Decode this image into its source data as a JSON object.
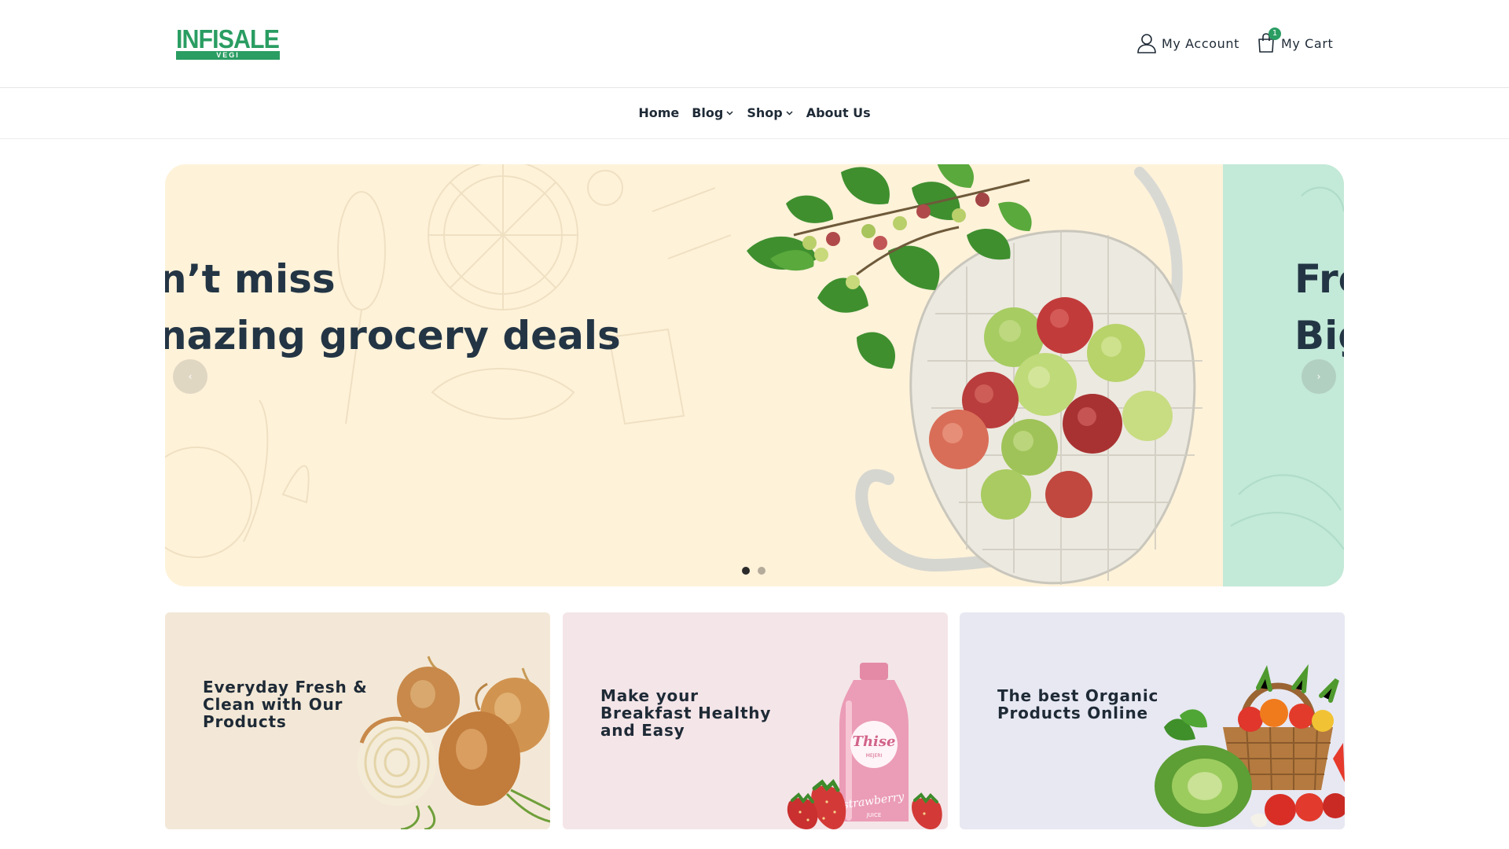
{
  "brand": {
    "name": "INFISALE",
    "sub": "VEGI",
    "color": "#2a9d62"
  },
  "header": {
    "account_label": "My Account",
    "cart_label": "My Cart",
    "cart_count": "1",
    "account_icon": "user-icon",
    "cart_icon": "shopping-bag-icon"
  },
  "nav": {
    "items": [
      {
        "label": "Home",
        "dropdown": false
      },
      {
        "label": "Blog",
        "dropdown": true
      },
      {
        "label": "Shop",
        "dropdown": true
      },
      {
        "label": "About Us",
        "dropdown": false
      }
    ]
  },
  "hero": {
    "slides": [
      {
        "line1": "n’t miss",
        "line2": "nazing grocery deals",
        "bg": "#fef2d9"
      },
      {
        "line1": "Fre",
        "line2": "Big",
        "bg": "#c3e9d8"
      }
    ],
    "prev_label": "‹",
    "next_label": "›",
    "active_dot": 0
  },
  "promos": [
    {
      "title": "Everyday Fresh & Clean with Our Products",
      "bg": "#f3e8d7",
      "art": "onions"
    },
    {
      "title": "Make your Breakfast Healthy and Easy",
      "bg": "#f4e5e8",
      "art": "strawberry-juice",
      "bottle_text": "Thise",
      "bottle_sub": "MEJERI",
      "bottle_script": "strawberry",
      "bottle_tail": "JUICE"
    },
    {
      "title": "The best Organic Products Online",
      "bg": "#e7e8f2",
      "art": "vegetable-basket"
    }
  ]
}
